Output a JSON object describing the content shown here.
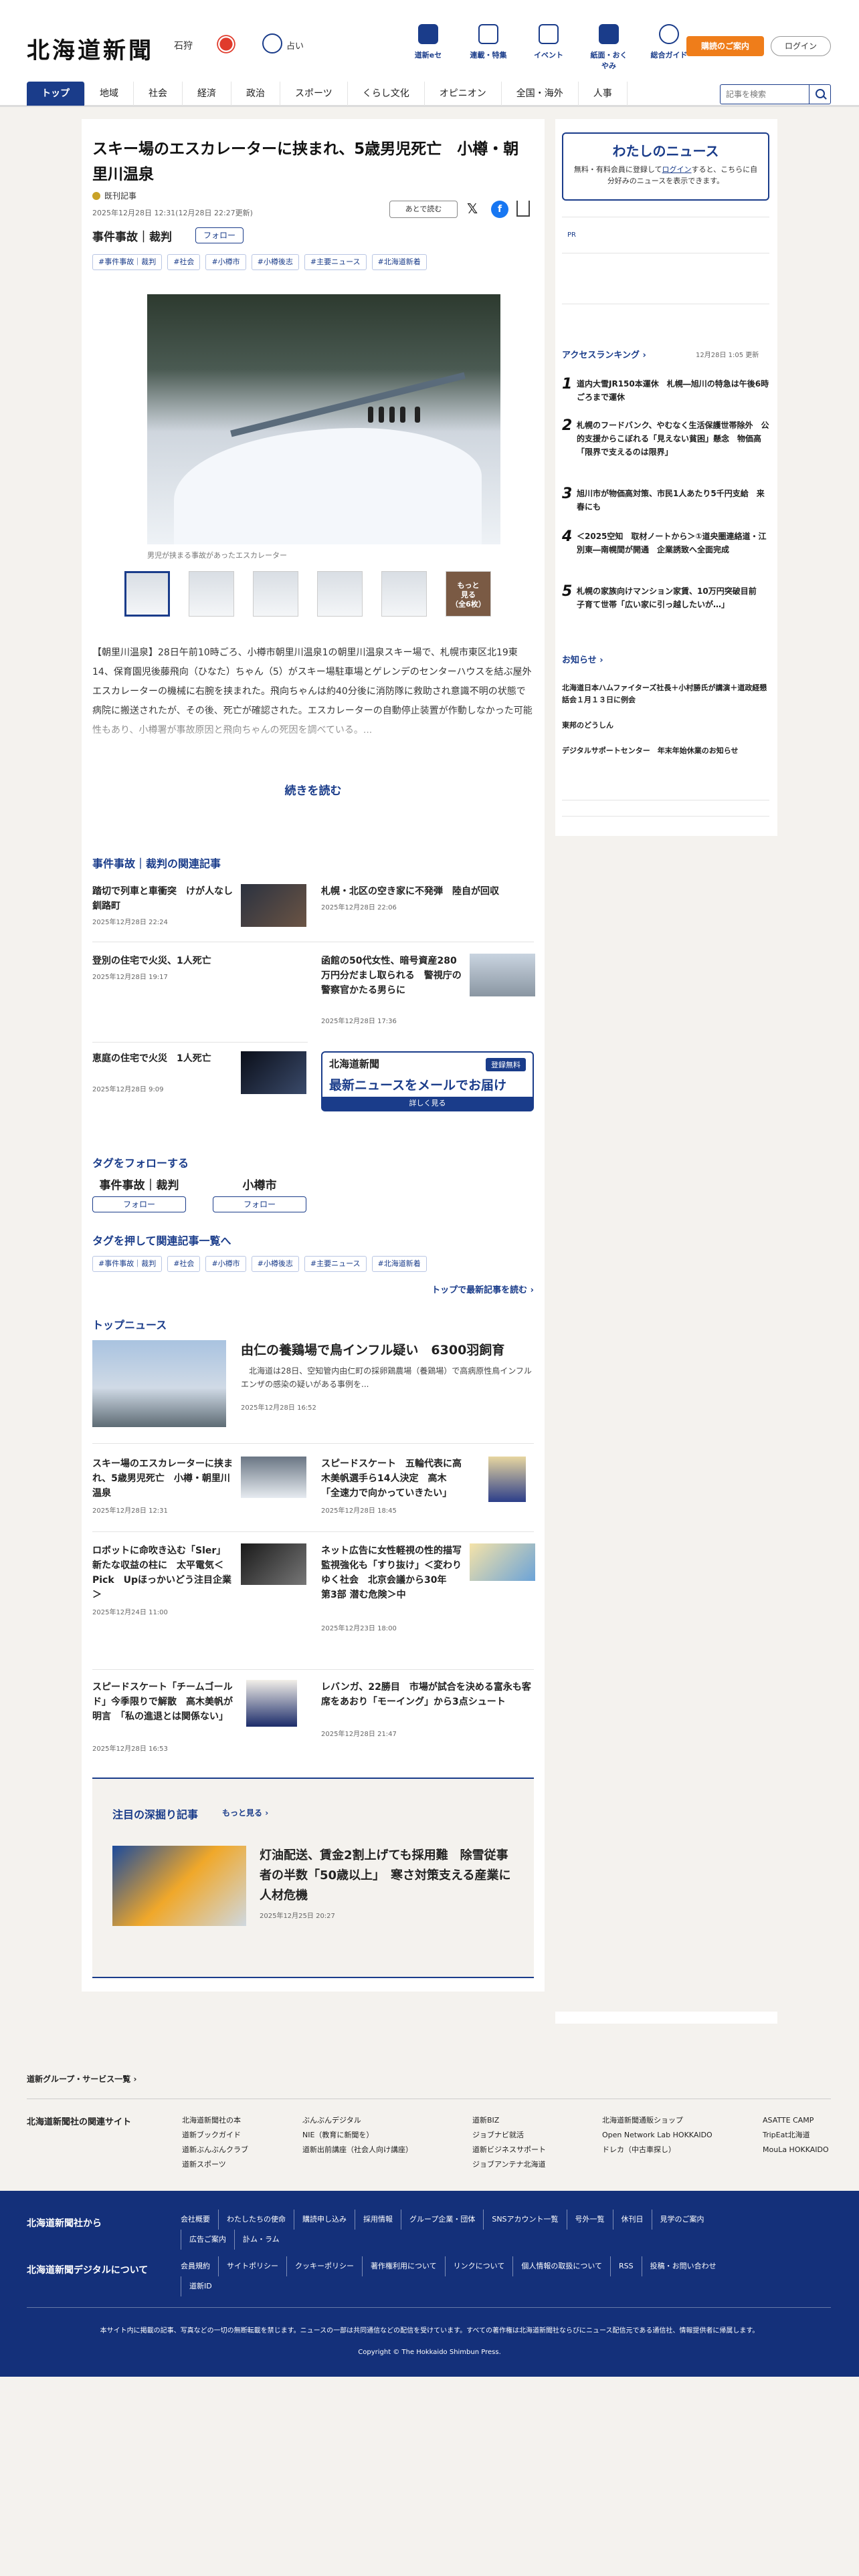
{
  "header": {
    "logo": "北海道新聞",
    "location": "石狩",
    "fortune_label": "占い",
    "icons": [
      "道新eセ",
      "連載・特集",
      "イベント",
      "紙面・おくやみ",
      "総合ガイド"
    ],
    "subscribe_label": "購読のご案内",
    "login_label": "ログイン",
    "search_placeholder": "記事を検索",
    "nav": [
      "トップ",
      "地域",
      "社会",
      "経済",
      "政治",
      "スポーツ",
      "くらし文化",
      "オピニオン",
      "全国・海外",
      "人事"
    ]
  },
  "article": {
    "title": "スキー場のエスカレーターに挟まれ、5歳男児死亡　小樽・朝里川温泉",
    "reporter": "既刊記事",
    "date": "2025年12月28日 12:31(12月28日 22:27更新)",
    "later_label": "あとで読む",
    "category": "事件事故｜裁判",
    "follow_label": "フォロー",
    "tags": [
      "#事件事故｜裁判",
      "#社会",
      "#小樽市",
      "#小樽後志",
      "#主要ニュース",
      "#北海道新着"
    ],
    "caption": "男児が挟まる事故があったエスカレーター",
    "more_photos": "もっと\n見る\n（全6枚）",
    "body": "【朝里川温泉】28日午前10時ごろ、小樽市朝里川温泉1の朝里川温泉スキー場で、札幌市東区北19東14、保育園児後藤飛向（ひなた）ちゃん（5）がスキー場駐車場とゲレンデのセンターハウスを結ぶ屋外エスカレーターの機械に右腕を挟まれた。飛向ちゃんは約40分後に消防隊に救助され意識不明の状態で病院に搬送されたが、その後、死亡が確認された。エスカレーターの自動停止装置が作動しなかった可能性もあり、小樽署が事故原因と飛向ちゃんの死因を調べている。...",
    "read_more": "続きを読む"
  },
  "related": {
    "heading": "事件事故｜裁判の関連記事",
    "items": [
      {
        "title": "踏切で列車と車衝突　けが人なし　釧路町",
        "date": "2025年12月28日 22:24"
      },
      {
        "title": "札幌・北区の空き家に不発弾　陸自が回収",
        "date": "2025年12月28日 22:06"
      },
      {
        "title": "登別の住宅で火災、1人死亡",
        "date": "2025年12月28日 19:17"
      },
      {
        "title": "函館の50代女性、暗号資産280万円分だまし取られる　警視庁の警察官かたる男らに",
        "date": "2025年12月28日 17:36"
      },
      {
        "title": "恵庭の住宅で火災　1人死亡",
        "date": "2025年12月28日 9:09"
      }
    ],
    "banner": {
      "logo": "北海道新聞",
      "free": "登録無料",
      "title": "最新ニュースをメールでお届け",
      "button": "詳しく見る"
    }
  },
  "follow_tags": {
    "heading": "タグをフォローする",
    "items": [
      "事件事故｜裁判",
      "小樽市"
    ],
    "follow_label": "フォロー"
  },
  "tag_list": {
    "heading": "タグを押して関連記事一覧へ",
    "tags": [
      "#事件事故｜裁判",
      "#社会",
      "#小樽市",
      "#小樽後志",
      "#主要ニュース",
      "#北海道新着"
    ],
    "more": "トップで最新記事を読む"
  },
  "top_news": {
    "heading": "トップニュース",
    "featured": {
      "title": "由仁の養鶏場で鳥インフル疑い　6300羽飼育",
      "summary": "　北海道は28日、空知管内由仁町の採卵鶏農場（養鶏場）で高病原性鳥インフルエンザの感染の疑いがある事例を...",
      "date": "2025年12月28日 16:52"
    },
    "items": [
      {
        "title": "スキー場のエスカレーターに挟まれ、5歳男児死亡　小樽・朝里川温泉",
        "date": "2025年12月28日 12:31"
      },
      {
        "title": "スピードスケート　五輪代表に高木美帆選手ら14人決定　高木「全速力で向かっていきたい」",
        "date": "2025年12月28日 18:45"
      },
      {
        "title": "ロボットに命吹き込む「Sler」 新たな収益の柱に　太平電気＜Pick　Upほっかいどう注目企業＞",
        "date": "2025年12月24日 11:00"
      },
      {
        "title": "ネット広告に女性軽視の性的描写　監視強化も「すり抜け」＜変わりゆく社会　北京会議から30年　第3部 潜む危険＞中",
        "date": "2025年12月23日 18:00"
      },
      {
        "title": "スピードスケート「チームゴールド」今季限りで解散　高木美帆が明言　「私の進退とは関係ない」",
        "date": "2025年12月28日 16:53"
      },
      {
        "title": "レバンガ、22勝目　市場が試合を決める富永も客席をあおり「モーイング」から3点シュート",
        "date": "2025年12月28日 21:47"
      }
    ]
  },
  "deep": {
    "heading": "注目の深掘り記事",
    "more": "もっと見る",
    "title": "灯油配送、賃金2割上げても採用難　除雪従事者の半数「50歳以上」　寒さ対策支える産業に人材危機",
    "date": "2025年12月25日 20:27"
  },
  "sidebar": {
    "mynews_title": "わたしのニュース",
    "mynews_text_a": "無料・有料会員に登録して",
    "mynews_link": "ログイン",
    "mynews_text_b": "すると、こちらに自分好みのニュースを表示できます。",
    "ad_label": "PR",
    "ranking_heading": "アクセスランキング",
    "ranking_updated": "12月28日 1:05 更新",
    "ranking": [
      "道内大雪JR150本運休　札幌―旭川の特急は午後6時ごろまで運休",
      "札幌のフードバンク、やむなく生活保護世帯除外　公的支援からこぼれる「見えない貧困」懸念　物価高「限界で支えるのは限界」",
      "旭川市が物価高対策、市民1人あたり5千円支給　来春にも",
      "＜2025空知　取材ノートから＞①道央圏連絡道・江別東―南幌間が開通　企業誘致へ全面完成",
      "札幌の家族向けマンション家賃、10万円突破目前　子育て世帯「広い家に引っ越したいが…」"
    ],
    "notice_heading": "お知らせ",
    "notices": [
      "北海道日本ハムファイターズ社長＋小村勝氏が講演＋道政経懇話会１月１３日に例会",
      "東邦のどうしん",
      "デジタルサポートセンター　年末年始休業のお知らせ"
    ]
  },
  "footer": {
    "group_link": "道新グループ・サービス一覧",
    "related_sites_heading": "北海道新聞社の関連サイト",
    "cols": [
      [
        "北海道新聞社の本",
        "道新ブックガイド",
        "道新ぶんぶんクラブ",
        "道新スポーツ"
      ],
      [
        "ぶんぶんデジタル",
        "NIE（教育に新聞を）",
        "道新出前講座（社会人向け講座）"
      ],
      [
        "道新BIZ",
        "ジョブナビ就活",
        "道新ビジネスサポート",
        "ジョブアンテナ北海道"
      ],
      [
        "北海道新聞通販ショップ",
        "Open Network Lab HOKKAIDO",
        "ドレカ（中古車探し）"
      ],
      [
        "ASATTE CAMP",
        "TripEat北海道",
        "MouLa HOKKAIDO"
      ]
    ],
    "from_company": "北海道新聞社から",
    "company_links": [
      "会社概要",
      "わたしたちの使命",
      "購読申し込み",
      "採用情報",
      "グループ企業・団体",
      "SNSアカウント一覧",
      "号外一覧",
      "休刊日",
      "見学のご案内",
      "広告ご案内",
      "訃ム・ラム"
    ],
    "about_digital": "北海道新聞デジタルについて",
    "digital_links": [
      "会員規約",
      "サイトポリシー",
      "クッキーポリシー",
      "著作権利用について",
      "リンクについて",
      "個人情報の取扱について",
      "RSS",
      "投稿・お問い合わせ",
      "道新ID"
    ],
    "note": "本サイト内に掲載の記事、写真などの一切の無断転載を禁じます。ニュースの一部は共同通信などの配信を受けています。すべての著作権は北海道新聞社ならびにニュース配信元である通信社、情報提供者に帰属します。",
    "copyright": "Copyright © The Hokkaido Shimbun Press."
  }
}
